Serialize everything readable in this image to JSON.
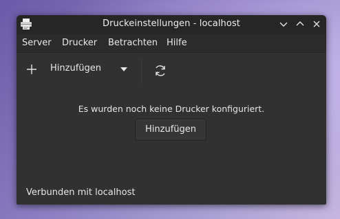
{
  "window": {
    "title": "Druckeinstellungen - localhost",
    "app_icon": "printer-icon"
  },
  "window_controls": {
    "minimize_icon": "chevron-down-icon",
    "maximize_icon": "chevron-up-icon",
    "close_icon": "close-icon"
  },
  "menubar": {
    "items": [
      {
        "label": "Server"
      },
      {
        "label": "Drucker"
      },
      {
        "label": "Betrachten"
      },
      {
        "label": "Hilfe"
      }
    ]
  },
  "toolbar": {
    "add_label": "Hinzufügen",
    "add_icon": "plus-icon",
    "dropdown_icon": "dropdown-arrow-icon",
    "refresh_icon": "refresh-icon"
  },
  "main": {
    "empty_message": "Es wurden noch keine Drucker konfiguriert.",
    "add_button_label": "Hinzufügen"
  },
  "status": {
    "text": "Verbunden mit localhost"
  },
  "colors": {
    "window_bg": "#313131",
    "titlebar_bg": "#262626",
    "text": "#e6e6e6"
  }
}
